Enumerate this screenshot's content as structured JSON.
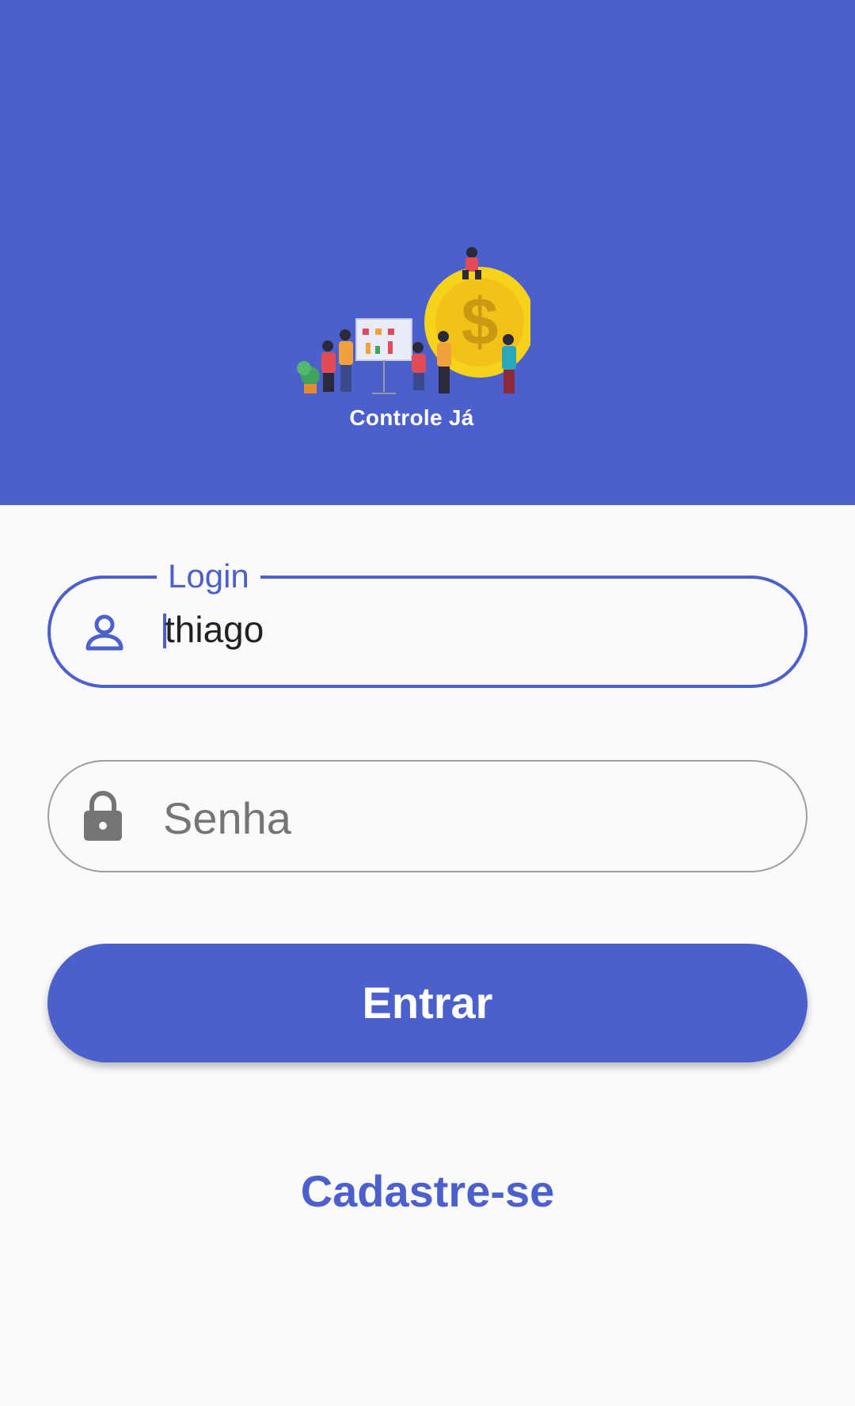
{
  "colors": {
    "primary": "#4B5FCD",
    "background": "#FAFAFA",
    "text": "#212121",
    "muted": "#757575",
    "border": "#9E9E9E",
    "coin": "#F6D21A"
  },
  "header": {
    "logo_text": "Controle Já"
  },
  "form": {
    "login": {
      "label": "Login",
      "value": "thiago",
      "icon": "person-icon"
    },
    "password": {
      "placeholder": "Senha",
      "icon": "lock-icon"
    }
  },
  "actions": {
    "submit_label": "Entrar",
    "signup_label": "Cadastre-se"
  }
}
